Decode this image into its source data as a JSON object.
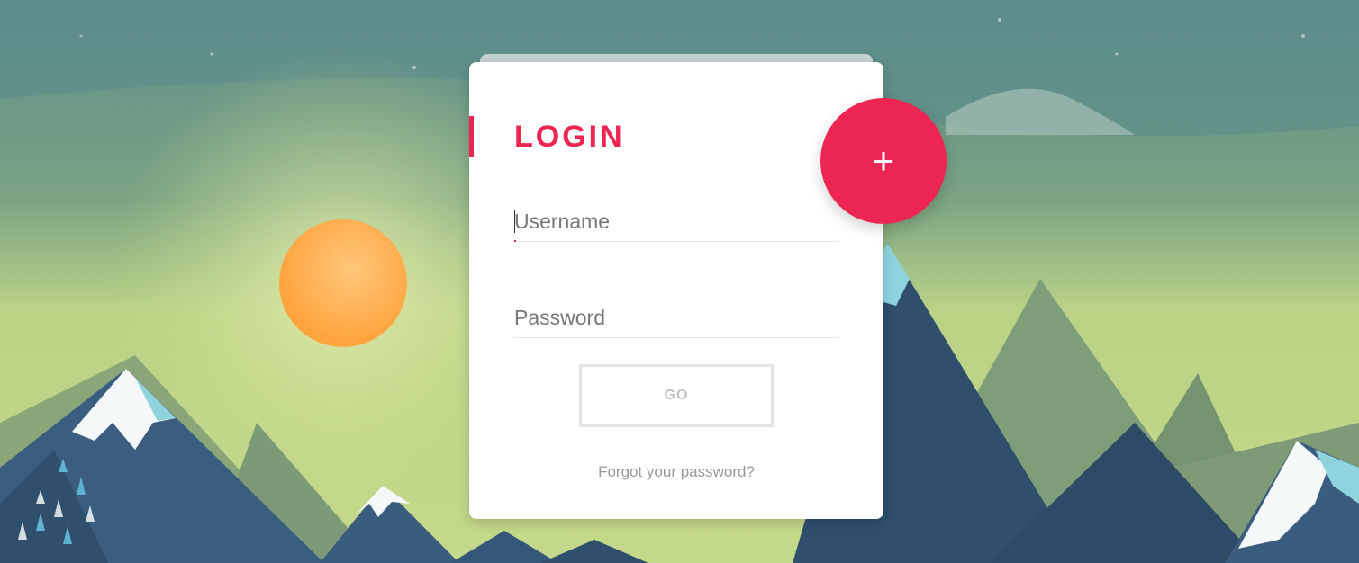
{
  "login": {
    "title": "LOGIN",
    "username_placeholder": "Username",
    "password_placeholder": "Password",
    "go_label": "GO",
    "forgot_label": "Forgot your password?"
  },
  "fab": {
    "icon": "plus-icon",
    "glyph": "+"
  },
  "colors": {
    "accent": "#ed2553",
    "sky_top": "#5e8c8a",
    "sky_glow": "#c2d98a",
    "sun": "#ffb45c",
    "mountain": "#34587a"
  }
}
